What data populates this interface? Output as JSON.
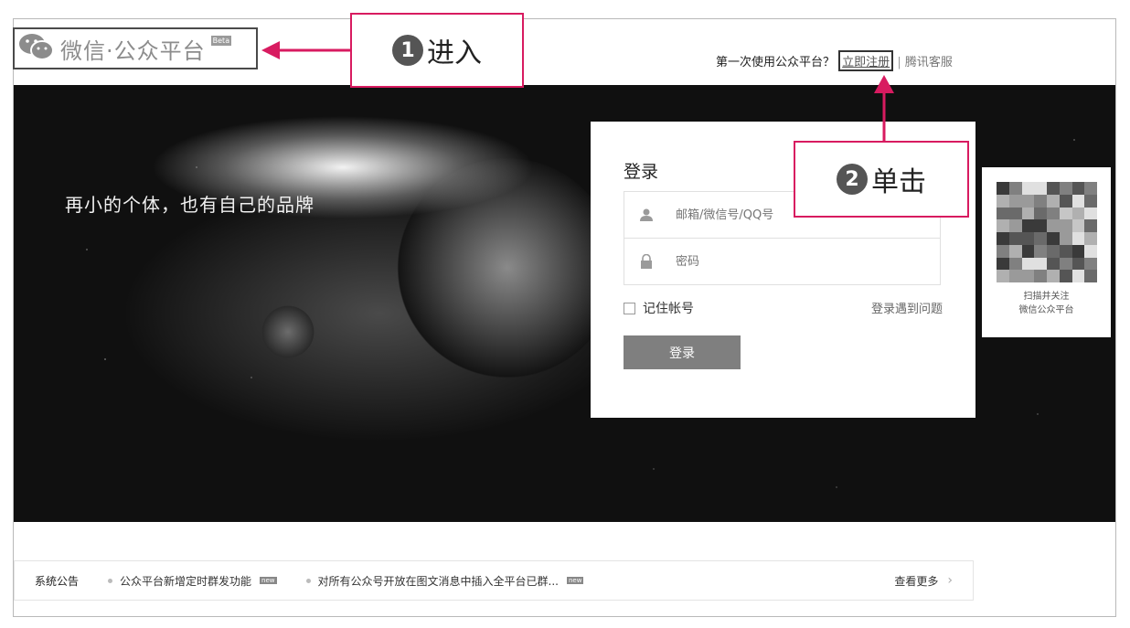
{
  "header": {
    "logo_text": "微信·公众平台",
    "beta": "Beta",
    "first_time": "第一次使用公众平台？",
    "register": "立即注册",
    "divider": "|",
    "support": "腾讯客服"
  },
  "hero": {
    "slogan": "再小的个体，也有自己的品牌"
  },
  "login": {
    "title": "登录",
    "username_placeholder": "邮箱/微信号/QQ号",
    "password_placeholder": "密码",
    "remember": "记住帐号",
    "problem": "登录遇到问题",
    "submit": "登录"
  },
  "qr": {
    "line1": "扫描并关注",
    "line2": "微信公众平台"
  },
  "footer": {
    "notice_label": "系统公告",
    "news": [
      {
        "text": "公众平台新增定时群发功能",
        "badge": "new"
      },
      {
        "text": "对所有公众号开放在图文消息中插入全平台已群...",
        "badge": "new"
      }
    ],
    "more": "查看更多"
  },
  "annotations": {
    "step1_num": "1",
    "step1_text": "进入",
    "step2_num": "2",
    "step2_text": "单击",
    "color": "#d81b60"
  },
  "icons": {
    "logo": "wechat-logo-icon",
    "user": "user-icon",
    "lock": "lock-icon",
    "chevron": "chevron-right-icon",
    "arrow": "arrow-icon"
  }
}
